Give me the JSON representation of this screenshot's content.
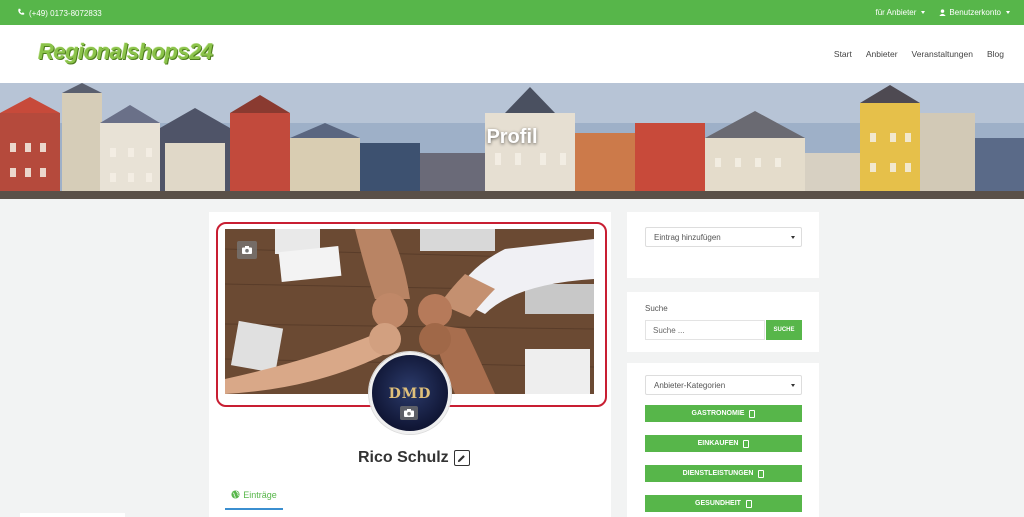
{
  "topbar": {
    "phone": "(+49) 0173-8072833",
    "for_vendors": "für Anbieter",
    "account": "Benutzerkonto",
    "bg_color": "#57b64a"
  },
  "header": {
    "logo": "Regionalshops24",
    "nav": [
      "Start",
      "Anbieter",
      "Veranstaltungen",
      "Blog"
    ]
  },
  "hero": {
    "title": "Profil"
  },
  "profile": {
    "avatar_text": "DMD",
    "name": "Rico Schulz",
    "tabs": [
      "Einträge"
    ]
  },
  "sidebar": {
    "add_entry_select": "Eintrag hinzufügen",
    "search": {
      "label": "Suche",
      "placeholder": "Suche ...",
      "button": "SUCHE"
    },
    "categories_select": "Anbieter-Kategorien",
    "categories": [
      {
        "label": "GASTRONOMIE"
      },
      {
        "label": "EINKAUFEN"
      },
      {
        "label": "DIENSTLEISTUNGEN"
      },
      {
        "label": "GESUNDHEIT"
      }
    ]
  },
  "icons": {
    "phone": "phone-icon",
    "user": "user-icon",
    "camera": "camera-icon",
    "edit": "edit-icon",
    "globe": "globe-icon"
  },
  "colors": {
    "accent": "#57b64a",
    "highlight_border": "#c81e32",
    "tab_underline": "#3b8fd0"
  }
}
